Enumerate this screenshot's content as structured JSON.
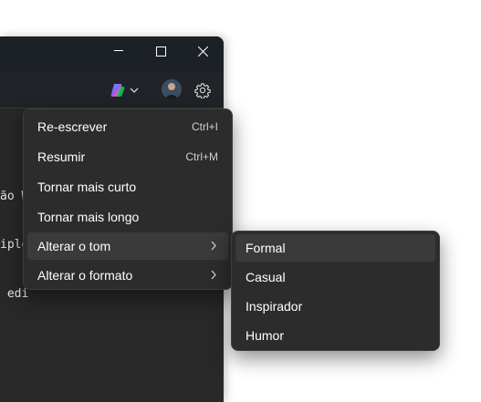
{
  "editor": {
    "lines": [
      "ão W",
      "iplo",
      " edi"
    ]
  },
  "toolbar": {
    "copilot_icon": "copilot-icon",
    "chevron_icon": "chevron-down-icon",
    "gear_icon": "gear-icon"
  },
  "context_menu": {
    "items": [
      {
        "label": "Re-escrever",
        "shortcut": "Ctrl+I"
      },
      {
        "label": "Resumir",
        "shortcut": "Ctrl+M"
      },
      {
        "label": "Tornar mais curto",
        "shortcut": ""
      },
      {
        "label": "Tornar mais longo",
        "shortcut": ""
      },
      {
        "label": "Alterar o tom",
        "shortcut": ""
      },
      {
        "label": "Alterar o formato",
        "shortcut": ""
      }
    ]
  },
  "tone_submenu": {
    "items": [
      {
        "label": "Formal"
      },
      {
        "label": "Casual"
      },
      {
        "label": "Inspirador"
      },
      {
        "label": "Humor"
      }
    ]
  },
  "colors": {
    "menu_bg": "#2c2c2c",
    "hover_bg": "#3a3a3a",
    "titlebar_bg": "#1c2027"
  }
}
